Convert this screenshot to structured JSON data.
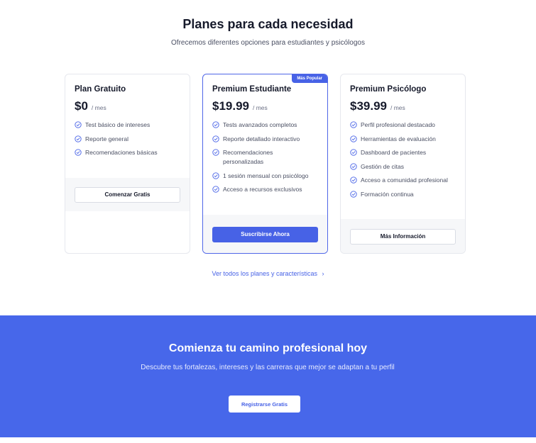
{
  "header": {
    "title": "Planes para cada necesidad",
    "subtitle": "Ofrecemos diferentes opciones para estudiantes y psicólogos"
  },
  "plans": [
    {
      "name": "Plan Gratuito",
      "price": "$0",
      "period": "/ mes",
      "features": [
        "Test básico de intereses",
        "Reporte general",
        "Recomendaciones básicas"
      ],
      "button": "Comenzar Gratis"
    },
    {
      "name": "Premium Estudiante",
      "price": "$19.99",
      "period": "/ mes",
      "badge": "Más Popular",
      "features": [
        "Tests avanzados completos",
        "Reporte detallado interactivo",
        "Recomendaciones personalizadas",
        "1 sesión mensual con psicólogo",
        "Acceso a recursos exclusivos"
      ],
      "button": "Suscribirse Ahora"
    },
    {
      "name": "Premium Psicólogo",
      "price": "$39.99",
      "period": "/ mes",
      "features": [
        "Perfil profesional destacado",
        "Herramientas de evaluación",
        "Dashboard de pacientes",
        "Gestión de citas",
        "Acceso a comunidad profesional",
        "Formación continua"
      ],
      "button": "Más Información"
    }
  ],
  "all_plans_link": "Ver todos los planes y características",
  "cta": {
    "title": "Comienza tu camino profesional hoy",
    "text": "Descubre tus fortalezas, intereses y las carreras que mejor se adaptan a tu perfil",
    "button": "Registrarse Gratis"
  },
  "colors": {
    "accent": "#4762e6",
    "cta_background": "#4767ea"
  },
  "icons": {
    "feature": "check-circle-icon",
    "link_arrow": "chevron-right-icon"
  }
}
